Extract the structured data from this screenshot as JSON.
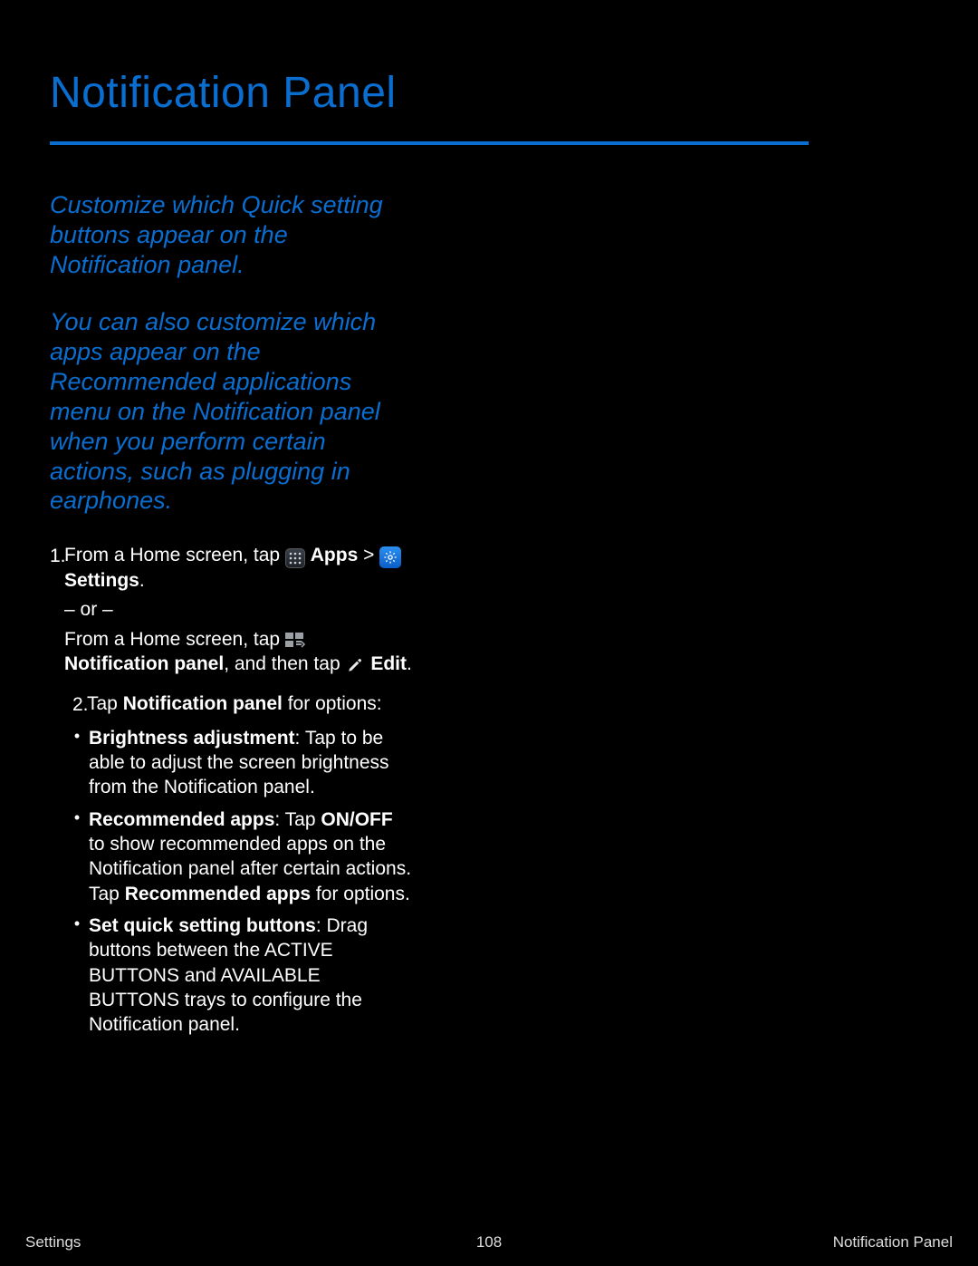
{
  "heading": "Notification Panel",
  "intro1": "Customize which Quick setting buttons appear on the Notification panel.",
  "intro2": "You can also customize which apps appear on the Recommended applications menu on the Notification panel when you perform certain actions, such as plugging in earphones.",
  "step1_num": "1.",
  "step1a": "From a Home screen, tap ",
  "step1b_bold": "Apps",
  "step1c": " > ",
  "step1d_bold": "Settings",
  "step1e": ".",
  "or_dash": "– or –",
  "alt1": "From a Home screen, tap ",
  "alt2_bold": "Notification panel",
  "alt3": ", and then tap ",
  "alt4_bold": "Edit",
  "alt5": ".",
  "step2_num": "2.",
  "step2a": "Tap ",
  "step2b_bold": "Notification panel",
  "step2c": " for options:",
  "opt_bullet": "•",
  "opt1a_bold": "Brightness adjustment",
  "opt1b": ": Tap to be able to adjust the screen brightness from the Notification panel.",
  "opt2a_bold": "Recommended apps",
  "opt2b": ": Tap ",
  "opt2c_bold": "ON/OFF",
  "opt2d": " to show recommended apps on the Notification panel after certain actions. Tap ",
  "opt2e_bold": "Recommended apps",
  "opt2f": " for options.",
  "opt3a_bold": "Set quick setting buttons",
  "opt3b": ": Drag buttons between the ACTIVE BUTTONS and AVAILABLE BUTTONS trays to configure the Notification panel.",
  "footer_left": "Settings",
  "footer_center": "108",
  "footer_right": "Notification Panel"
}
